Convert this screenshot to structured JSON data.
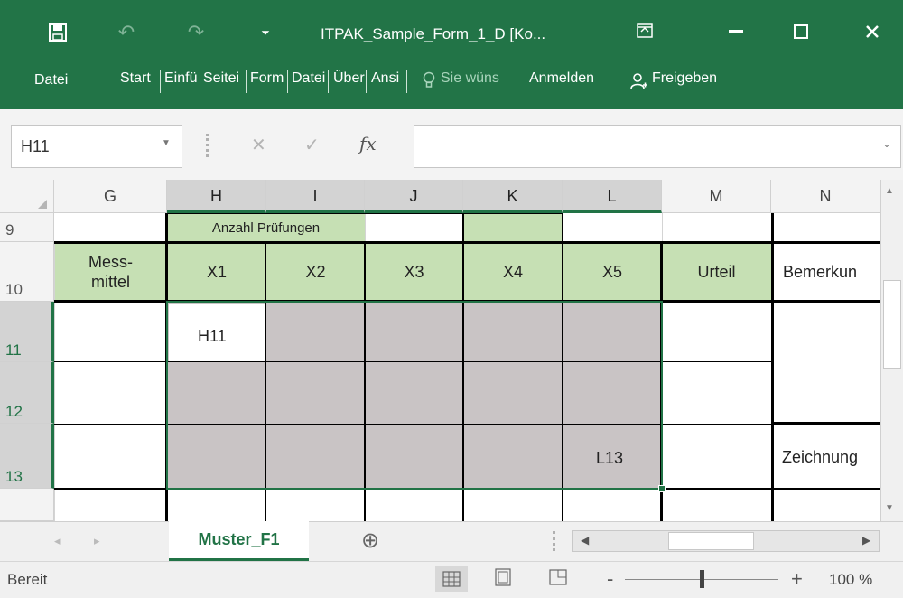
{
  "window": {
    "title": "ITPAK_Sample_Form_1_D  [Ko...",
    "minimize": "—",
    "maximize": "☐",
    "close": "✕",
    "ribbon_display": "⊡"
  },
  "qat": {
    "save": "🖫",
    "undo": "↶",
    "redo": "↷",
    "customize": "⏷"
  },
  "ribbon_tabs": [
    "Datei",
    "Start",
    "Einfü",
    "Seitei",
    "Form",
    "Datei",
    "Über",
    "Ansi",
    "Sie wüns",
    "Anmelden",
    "Freigeben"
  ],
  "formula_bar": {
    "name_box": "H11",
    "cancel": "✕",
    "enter": "✓",
    "fx": "fx",
    "content": ""
  },
  "columns": [
    "G",
    "H",
    "I",
    "J",
    "K",
    "L",
    "M",
    "N"
  ],
  "rows": [
    "9",
    "10",
    "11",
    "12",
    "13"
  ],
  "cells": {
    "H9": "Anzahl Prüfungen",
    "G10": "Mess-\nmittel",
    "H10": "X1",
    "I10": "X2",
    "J10": "X3",
    "K10": "X4",
    "L10": "X5",
    "M10": "Urteil",
    "N10": "Bemerkun",
    "H11": "H11",
    "L13": "L13",
    "N13": "Zeichnung"
  },
  "sheet_tab": "Muster_F1",
  "add_sheet": "⊕",
  "status": {
    "text": "Bereit",
    "zoom": "100 %",
    "zoom_minus": "-",
    "zoom_plus": "+",
    "zoom_level": 1.0
  },
  "colors": {
    "accent": "#227447",
    "header_green": "#c6e0b4",
    "selection_grey": "#c9c4c5"
  }
}
